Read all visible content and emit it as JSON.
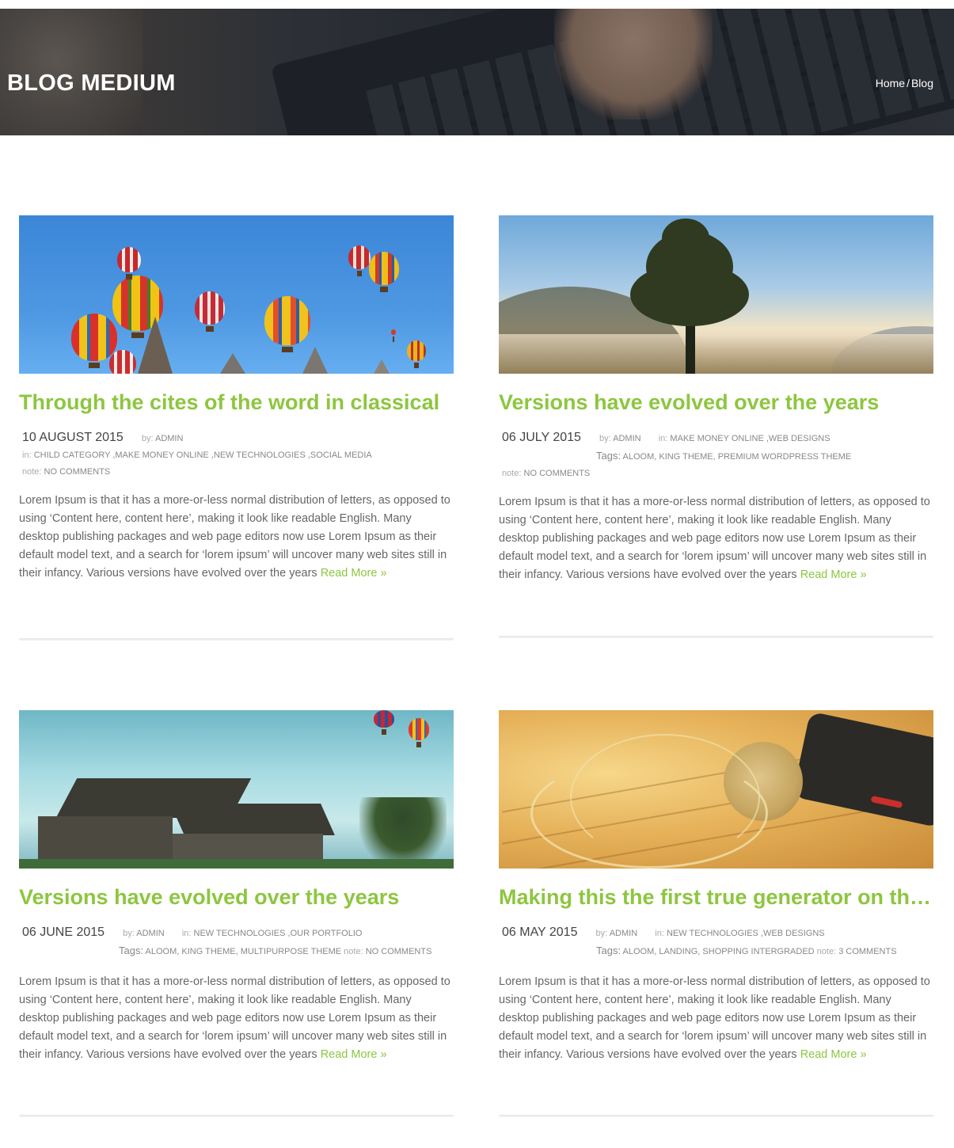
{
  "header": {
    "title": "BLOG MEDIUM",
    "breadcrumb": {
      "home": "Home",
      "separator": "/",
      "current": "Blog"
    }
  },
  "colors": {
    "accent": "#8dc63f",
    "text": "#666666",
    "meta": "#999999"
  },
  "posts": [
    {
      "image": "hot-air-balloons-image",
      "title": "Through the cites of the word in classical",
      "date": "10 AUGUST 2015",
      "by_label": "by:",
      "author": "ADMIN",
      "in_label": "in:",
      "categories": [
        "CHILD CATEGORY",
        ",MAKE MONEY ONLINE",
        ",NEW TECHNOLOGIES",
        ",SOCIAL MEDIA"
      ],
      "tags_label": "",
      "tags": [],
      "note_label": "note:",
      "comments": "NO COMMENTS",
      "excerpt": "Lorem Ipsum is that it has a more-or-less normal distribution of letters, as opposed to using ‘Content here, content here’, making it look like readable English. Many desktop publishing packages and web page editors now use Lorem Ipsum as their default model text, and a search for ‘lorem ipsum’ will uncover many web sites still in their infancy. Various versions have evolved over the years ",
      "read_more": "Read More »"
    },
    {
      "image": "tree-landscape-image",
      "title": "Versions have evolved over the years",
      "date": "06 JULY 2015",
      "by_label": "by:",
      "author": "ADMIN",
      "in_label": "in:",
      "categories": [
        "MAKE MONEY ONLINE",
        ",WEB DESIGNS"
      ],
      "tags_label": "Tags:",
      "tags": [
        "ALOOM,",
        "KING THEME,",
        "PREMIUM WORDPRESS THEME"
      ],
      "note_label": "note:",
      "comments": "NO COMMENTS",
      "excerpt": "Lorem Ipsum is that it has a more-or-less normal distribution of letters, as opposed to using ‘Content here, content here’, making it look like readable English. Many desktop publishing packages and web page editors now use Lorem Ipsum as their default model text, and a search for ‘lorem ipsum’ will uncover many web sites still in their infancy. Various versions have evolved over the years ",
      "read_more": "Read More »"
    },
    {
      "image": "old-house-image",
      "title": "Versions have evolved over the years",
      "date": "06 JUNE 2015",
      "by_label": "by:",
      "author": "ADMIN",
      "in_label": "in:",
      "categories": [
        "NEW TECHNOLOGIES",
        ",OUR PORTFOLIO"
      ],
      "tags_label": "Tags:",
      "tags": [
        "ALOOM,",
        "KING THEME,",
        "MULTIPURPOSE THEME"
      ],
      "note_label": "note:",
      "comments": "NO COMMENTS",
      "excerpt": "Lorem Ipsum is that it has a more-or-less normal distribution of letters, as opposed to using ‘Content here, content here’, making it look like readable English. Many desktop publishing packages and web page editors now use Lorem Ipsum as their default model text, and a search for ‘lorem ipsum’ will uncover many web sites still in their infancy. Various versions have evolved over the years ",
      "read_more": "Read More »"
    },
    {
      "image": "headphones-phone-image",
      "title": "Making this the first true generator on the Internet",
      "date": "06 MAY 2015",
      "by_label": "by:",
      "author": "ADMIN",
      "in_label": "in:",
      "categories": [
        "NEW TECHNOLOGIES",
        ",WEB DESIGNS"
      ],
      "tags_label": "Tags:",
      "tags": [
        "ALOOM,",
        "LANDING,",
        "SHOPPING INTERGRADED"
      ],
      "note_label": "note:",
      "comments": "3 COMMENTS",
      "excerpt": "Lorem Ipsum is that it has a more-or-less normal distribution of letters, as opposed to using ‘Content here, content here’, making it look like readable English. Many desktop publishing packages and web page editors now use Lorem Ipsum as their default model text, and a search for ‘lorem ipsum’ will uncover many web sites still in their infancy. Various versions have evolved over the years ",
      "read_more": "Read More »"
    }
  ]
}
